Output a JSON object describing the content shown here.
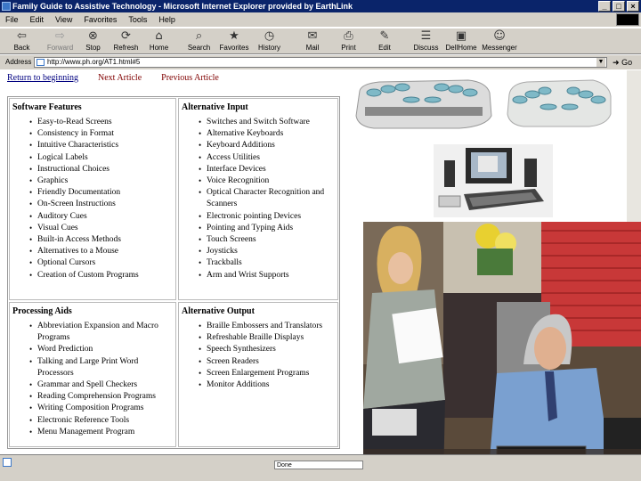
{
  "window": {
    "title": "Family Guide to Assistive Technology - Microsoft Internet Explorer provided by EarthLink",
    "controls": [
      "_",
      "□",
      "×"
    ]
  },
  "menu": [
    "File",
    "Edit",
    "View",
    "Favorites",
    "Tools",
    "Help"
  ],
  "toolbar": [
    {
      "label": "Back",
      "icon": "back-arrow-icon",
      "glyph": "⇦"
    },
    {
      "label": "Forward",
      "icon": "forward-arrow-icon",
      "glyph": "⇨"
    },
    {
      "label": "Stop",
      "icon": "stop-icon",
      "glyph": "⊗"
    },
    {
      "label": "Refresh",
      "icon": "refresh-icon",
      "glyph": "⟳"
    },
    {
      "label": "Home",
      "icon": "home-icon",
      "glyph": "⌂"
    },
    {
      "label": "Search",
      "icon": "search-icon",
      "glyph": "⌕"
    },
    {
      "label": "Favorites",
      "icon": "favorites-icon",
      "glyph": "★"
    },
    {
      "label": "History",
      "icon": "history-icon",
      "glyph": "◷"
    },
    {
      "label": "Mail",
      "icon": "mail-icon",
      "glyph": "✉"
    },
    {
      "label": "Print",
      "icon": "print-icon",
      "glyph": "⎙"
    },
    {
      "label": "Edit",
      "icon": "edit-icon",
      "glyph": "✎"
    },
    {
      "label": "Discuss",
      "icon": "discuss-icon",
      "glyph": "☰"
    },
    {
      "label": "DellHome",
      "icon": "dellhome-icon",
      "glyph": "▣"
    },
    {
      "label": "Messenger",
      "icon": "messenger-icon",
      "glyph": "☺"
    }
  ],
  "address": {
    "label": "Address",
    "url": "http://www.ph.org/AT1.html#5",
    "go": "Go"
  },
  "nav": {
    "return": "Return to beginning",
    "next": "Next Article",
    "previous": "Previous Article"
  },
  "sections": {
    "software": {
      "heading": "Software Features",
      "items": [
        "Easy-to-Read Screens",
        "Consistency in Format",
        "Intuitive Characteristics",
        "Logical Labels",
        "Instructional Choices",
        "Graphics",
        "Friendly Documentation",
        "On-Screen Instructions",
        "Auditory Cues",
        "Visual Cues",
        "Built-in Access Methods",
        "Alternatives to a Mouse",
        "Optional Cursors",
        "Creation of Custom Programs"
      ]
    },
    "input": {
      "heading": "Alternative Input",
      "items": [
        "Switches and Switch Software",
        "Alternative Keyboards",
        "Keyboard Additions",
        "Access Utilities",
        "Interface Devices",
        "Voice Recognition",
        "Optical Character Recognition and Scanners",
        "Electronic pointing Devices",
        "Pointing and Typing Aids",
        "Touch Screens",
        "Joysticks",
        "Trackballs",
        "Arm and Wrist Supports"
      ]
    },
    "processing": {
      "heading": "Processing Aids",
      "items": [
        "Abbreviation Expansion and Macro Programs",
        "Word Prediction",
        "Talking and Large Print Word Processors",
        "Grammar and Spell Checkers",
        "Reading Comprehension Programs",
        "Writing Composition Programs",
        "Electronic Reference Tools",
        "Menu Management Program"
      ]
    },
    "output": {
      "heading": "Alternative Output",
      "items": [
        "Braille Embossers and Translators",
        "Refreshable Braille Displays",
        "Speech Synthesizers",
        "Screen Readers",
        "Screen Enlargement Programs",
        "Monitor Additions"
      ]
    }
  },
  "status": {
    "text": "Done"
  },
  "colors": {
    "titlebar": "#0a246a",
    "chrome": "#d4d0c8",
    "link": "#000080",
    "visited": "#800000"
  }
}
